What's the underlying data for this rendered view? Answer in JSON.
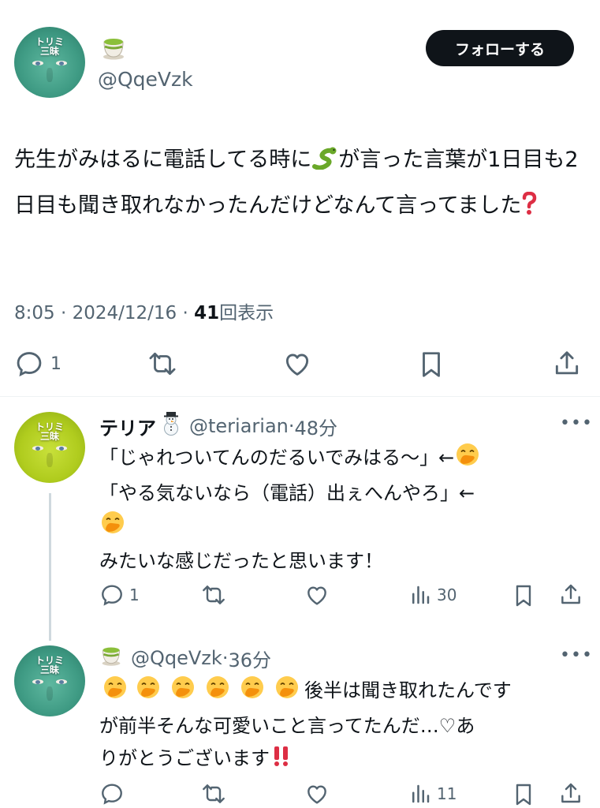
{
  "tweet": {
    "avatar_label": "トリミ 三昧",
    "name_emoji": "tea-cup",
    "handle": "@QqeVzk",
    "follow_label": "フォローする",
    "text_part1": "先生がみはるに電話してる時に",
    "text_part2": "が言った言葉が1日目も2日目も聞き取れなかったんだけどなんて言ってました",
    "time": "8:05",
    "date": "2024/12/16",
    "views_count": "41",
    "views_label": "回表示",
    "reply_count": "1"
  },
  "replies": [
    {
      "avatar_label": "トリミ 三昧",
      "name": "テリア",
      "handle": "@teriarian",
      "time": "48分",
      "line1": "「じゃれついてんのだるいでみはる〜」←",
      "line2": "「やる気ないなら（電話）出ぇへんやろ」←",
      "line3": "みたいな感じだったと思います！",
      "reply_count": "1",
      "views_count": "30"
    },
    {
      "avatar_label": "トリミ 三昧",
      "handle": "@QqeVzk",
      "time": "36分",
      "line1": "後半は聞き取れたんです",
      "line2": "が前半そんな可愛いこと言ってたんだ…♡あ",
      "line3": "りがとうございます",
      "views_count": "11"
    }
  ],
  "colors": {
    "text": "#0f1419",
    "secondary": "#536471",
    "button_bg": "#0f1419",
    "divider": "#eff3f4",
    "thread_line": "#cfd9de"
  },
  "icons": [
    "reply-icon",
    "retweet-icon",
    "like-icon",
    "bookmark-icon",
    "share-icon",
    "views-icon",
    "more-icon",
    "snake-emoji",
    "question-emoji",
    "snowman-emoji",
    "hand-over-mouth-emoji",
    "double-exclamation-emoji",
    "tea-emoji"
  ]
}
